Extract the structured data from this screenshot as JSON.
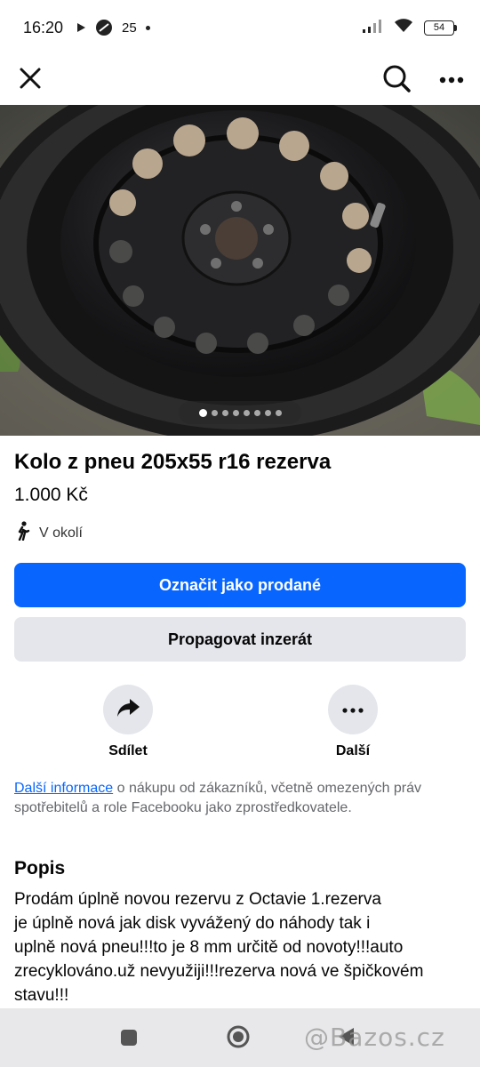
{
  "status_bar": {
    "time": "16:20",
    "temperature": "25",
    "battery": "54"
  },
  "icons": {
    "close": "close-icon",
    "search": "search-icon",
    "more": "more-horizontal-icon",
    "walk": "walking-person-icon",
    "share": "share-arrow-icon",
    "dots": "more-dots-icon"
  },
  "photo": {
    "slide_count": 8,
    "active_slide": 1
  },
  "listing": {
    "title": "Kolo z pneu 205x55 r16 rezerva",
    "price": "1.000 Kč",
    "location": "V okolí"
  },
  "buttons": {
    "mark_sold": "Označit jako prodané",
    "promote": "Propagovat inzerát"
  },
  "actions": {
    "share": "Sdílet",
    "more": "Další"
  },
  "info": {
    "link": "Další informace",
    "text": " o nákupu od zákazníků, včetně omezených práv spotřebitelů a role Facebooku jako zprostředkovatele."
  },
  "description": {
    "heading": "Popis",
    "lines": [
      "Prodám úplně novou rezervu z Octavie 1.rezerva",
      "je úplně nová jak disk vyvážený do náhody tak i",
      "uplně nová pneu!!!to je 8 mm určitě od novoty!!!auto",
      "zrecyklováno.už nevyužiji!!!rezerva nová ve špičkovém",
      "stavu!!!"
    ]
  },
  "watermark": "@Bazos.cz",
  "colors": {
    "primary": "#0866ff",
    "secondary": "#e4e6eb"
  }
}
